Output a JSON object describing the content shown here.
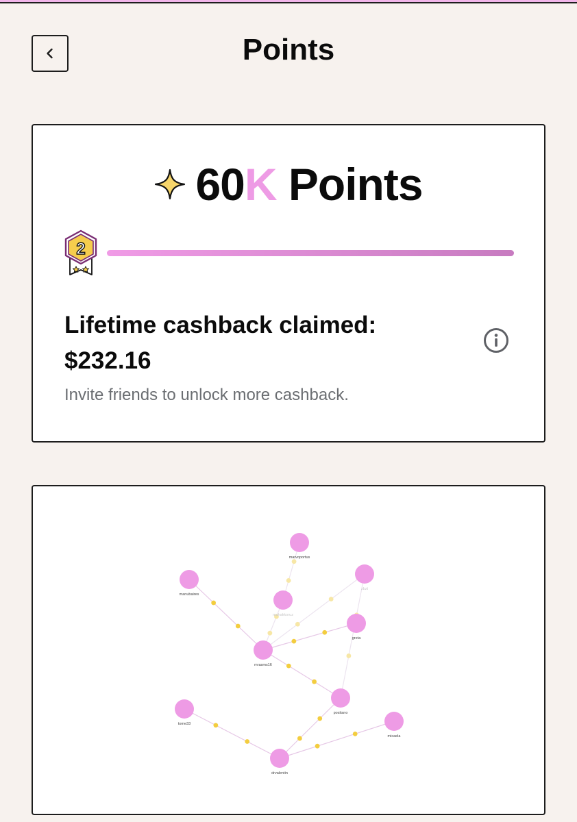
{
  "header": {
    "title": "Points",
    "back_icon": "chevron-left-icon"
  },
  "points_card": {
    "sparkle_icon": "sparkle-icon",
    "amount_number": "60",
    "amount_suffix": "K",
    "amount_label": "Points",
    "level_badge": "2",
    "level_progress": 1.0,
    "cashback_label": "Lifetime cashback claimed:",
    "cashback_value": "$232.16",
    "info_icon": "info-icon",
    "subtitle": "Invite friends to unlock more cashback.",
    "colors": {
      "accent": "#ee9be5",
      "progress_start": "#f09be6",
      "progress_end": "#c77bc0"
    }
  },
  "referral_graph": {
    "nodes": [
      {
        "label": "marvoportus",
        "faded": false
      },
      {
        "label": "manubaires",
        "faded": false
      },
      {
        "label": "mahakkoruz",
        "faded": true
      },
      {
        "label": "zbzt",
        "faded": true
      },
      {
        "label": "greta",
        "faded": false
      },
      {
        "label": "mrasms16",
        "faded": false
      },
      {
        "label": "positano",
        "faded": false
      },
      {
        "label": "tome33",
        "faded": false
      },
      {
        "label": "micaela",
        "faded": false
      },
      {
        "label": "drvalentin",
        "faded": false
      }
    ],
    "colors": {
      "node": "#ee9be5",
      "edge_dot": "#f3cd3f",
      "edge": "#e6c8e6"
    }
  }
}
